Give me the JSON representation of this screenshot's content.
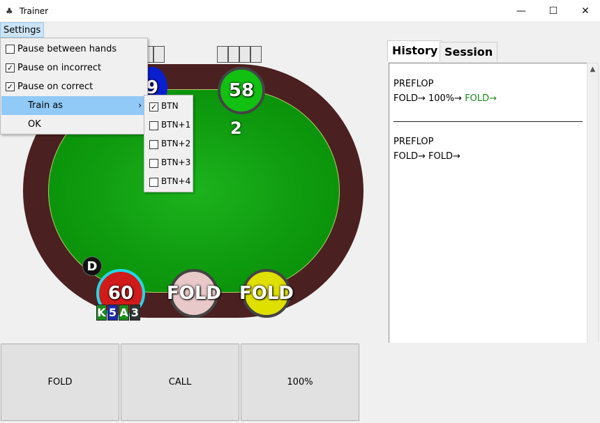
{
  "window": {
    "title": "Trainer",
    "minimize": "—",
    "maximize": "☐",
    "close": "✕"
  },
  "menubar": {
    "settings": "Settings"
  },
  "settings_menu": {
    "items": [
      {
        "label": "Pause between hands",
        "checked": false,
        "mark": ""
      },
      {
        "label": "Pause on incorrect",
        "checked": true,
        "mark": "✓"
      },
      {
        "label": "Pause on correct",
        "checked": true,
        "mark": "✓"
      },
      {
        "label": "Train as",
        "arrow": "›"
      },
      {
        "label": "OK"
      }
    ]
  },
  "train_as_menu": {
    "items": [
      {
        "label": "BTN",
        "mark": "✓"
      },
      {
        "label": "BTN+1",
        "mark": ""
      },
      {
        "label": "BTN+2",
        "mark": ""
      },
      {
        "label": "BTN+3",
        "mark": ""
      },
      {
        "label": "BTN+4",
        "mark": ""
      }
    ]
  },
  "table": {
    "seats": [
      {
        "text": "9",
        "color": "#0a1fd0"
      },
      {
        "text": "58",
        "color": "#11c011"
      },
      {
        "text": "60",
        "color": "#d11a1a",
        "ring": "#22d8e8"
      },
      {
        "text": "FOLD",
        "color": "#e8c8c8"
      },
      {
        "text": "FOLD",
        "color": "#e0e000"
      }
    ],
    "pot": "2",
    "dealer": "D",
    "hero_cards": [
      {
        "rank": "K",
        "color": "#1a8c1a"
      },
      {
        "rank": "5",
        "color": "#1a2ab0"
      },
      {
        "rank": "A",
        "color": "#1a8c1a"
      },
      {
        "rank": "3",
        "color": "#333333"
      }
    ]
  },
  "tabs": [
    "History",
    "Session"
  ],
  "history": {
    "block1": {
      "street": "PREFLOP",
      "a1": "FOLD→",
      "a2": "100%→",
      "a3": "FOLD→",
      "a3_color": "#1a8c1a"
    },
    "block2": {
      "street": "PREFLOP",
      "a1": "FOLD→",
      "a2": "FOLD→"
    }
  },
  "actions": [
    "FOLD",
    "CALL",
    "100%"
  ]
}
